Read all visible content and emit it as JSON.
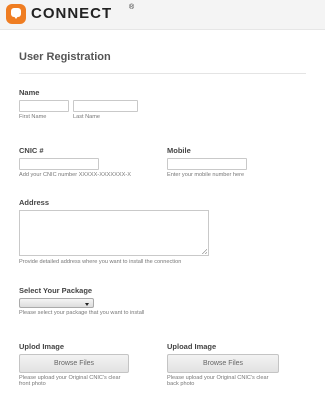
{
  "header": {
    "brand": "CONNECT",
    "brand_mark": "®"
  },
  "form": {
    "title": "User Registration",
    "name": {
      "label": "Name",
      "first_hint": "First Name",
      "last_hint": "Last Name",
      "first_value": "",
      "last_value": ""
    },
    "cnic": {
      "label": "CNIC #",
      "hint": "Add your CNIC number XXXXX-XXXXXXX-X",
      "value": ""
    },
    "mobile": {
      "label": "Mobile",
      "hint": "Enter your mobile number here",
      "value": ""
    },
    "address": {
      "label": "Address",
      "hint": "Provide detailed address where you want to install the connection",
      "value": ""
    },
    "package": {
      "label": "Select Your Package",
      "hint": "Please select your package that you want to install",
      "selected": ""
    },
    "upload_front": {
      "label": "Uplod Image",
      "button": "Browse Files",
      "hint_line1": "Please upload your Original CNIC's clear",
      "hint_line2": "front photo"
    },
    "upload_back": {
      "label": "Upload Image",
      "button": "Browse Files",
      "hint_line1": "Please upload your Original CNIC's clear",
      "hint_line2": "back photo"
    }
  },
  "colors": {
    "brand_orange": "#ef7d22",
    "header_bg": "#f4f4f4"
  }
}
